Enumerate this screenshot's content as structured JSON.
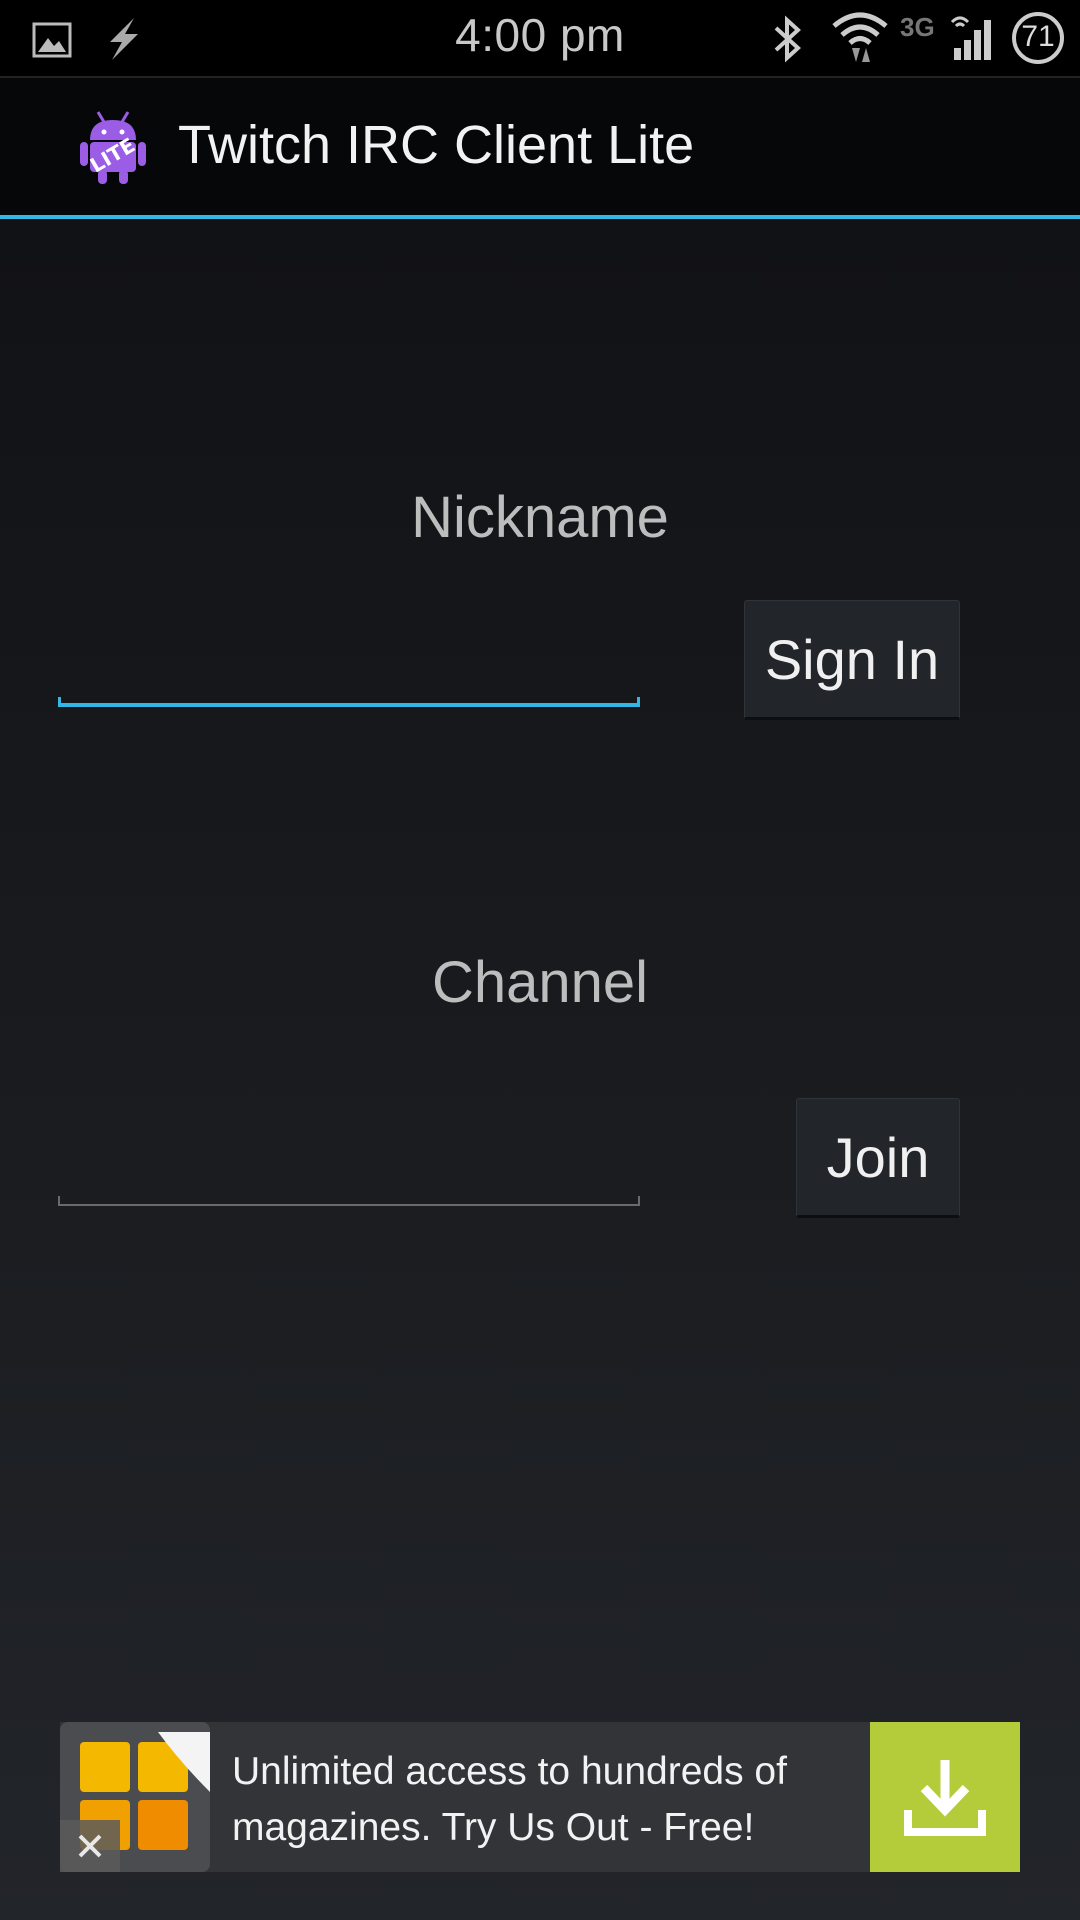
{
  "status_bar": {
    "time": "4:00 pm",
    "network_type": "3G",
    "battery_level": "71",
    "left_icons": [
      "gallery-icon",
      "flash-icon"
    ],
    "right_icons": [
      "bluetooth-icon",
      "wifi-icon",
      "signal-icon",
      "battery-icon"
    ]
  },
  "action_bar": {
    "title": "Twitch IRC Client Lite",
    "app_icon_badge": "LITE",
    "accent_color": "#33b5e5"
  },
  "form": {
    "nickname": {
      "label": "Nickname",
      "value": "",
      "button_label": "Sign In"
    },
    "channel": {
      "label": "Channel",
      "value": "",
      "button_label": "Join"
    }
  },
  "ad": {
    "text": "Unlimited access to hundreds of magazines. Try Us Out - Free!",
    "download_color": "#b5cc3a"
  }
}
